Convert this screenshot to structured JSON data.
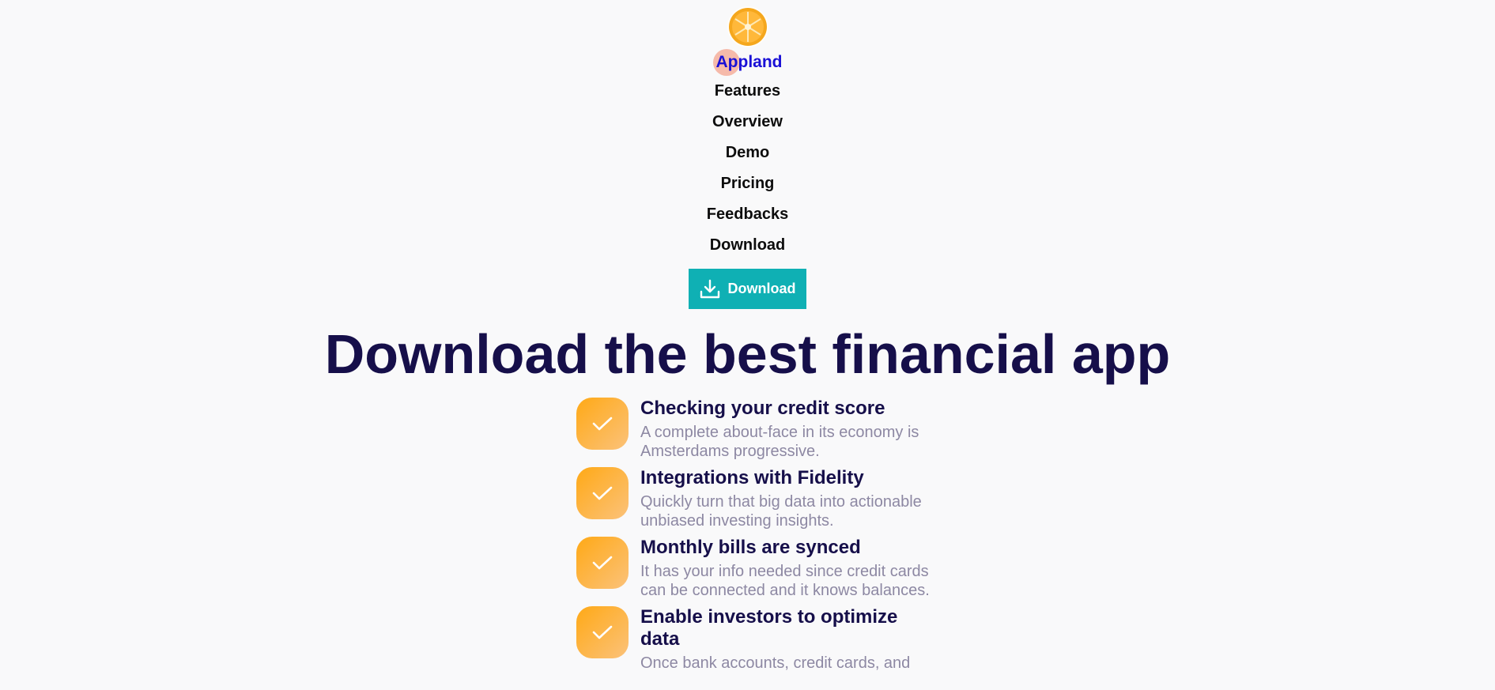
{
  "header": {
    "logo_icon": "orange-slice-icon",
    "brand": "Appland",
    "nav": [
      "Features",
      "Overview",
      "Demo",
      "Pricing",
      "Feedbacks",
      "Download"
    ],
    "cta": {
      "label": "Download",
      "icon": "download-icon"
    }
  },
  "hero": {
    "title": "Download the best financial app"
  },
  "features": [
    {
      "icon": "check-icon",
      "title": "Checking your credit score",
      "desc": "A complete about-face in its economy is Amsterdams progressive."
    },
    {
      "icon": "check-icon",
      "title": "Integrations with Fidelity",
      "desc": "Quickly turn that big data into actionable unbiased investing insights."
    },
    {
      "icon": "check-icon",
      "title": "Monthly bills are synced",
      "desc": "It has your info needed since credit cards can be connected and it knows balances."
    },
    {
      "icon": "check-icon",
      "title": "Enable investors to optimize data",
      "desc": "Once bank accounts, credit cards, and"
    }
  ],
  "colors": {
    "background": "#f9f9fa",
    "brand": "#1a10d6",
    "accent": "#0fb0b4",
    "title": "#160f4a",
    "muted": "#8d88a3",
    "check_gradient_start": "#ffa916",
    "check_gradient_end": "#fbc27a"
  }
}
